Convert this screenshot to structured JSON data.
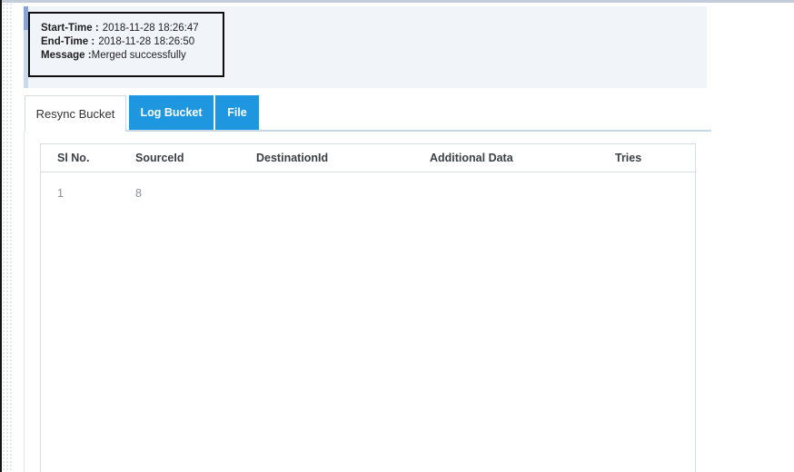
{
  "panel": {
    "start_time_label": "Start-Time :",
    "start_time_value": "2018-11-28 18:26:47",
    "end_time_label": "End-Time :",
    "end_time_value": "2018-11-28 18:26:50",
    "message_label": "Message :",
    "message_value": "Merged successfully"
  },
  "tabs": [
    {
      "label": "Resync Bucket",
      "active": true
    },
    {
      "label": "Log Bucket",
      "active": false
    },
    {
      "label": "File",
      "active": false
    }
  ],
  "table": {
    "columns": [
      "Sl No.",
      "SourceId",
      "DestinationId",
      "Additional Data",
      "Tries"
    ],
    "rows": [
      [
        "1",
        "8",
        "",
        "",
        ""
      ]
    ]
  },
  "colors": {
    "tab_blue": "#1e96e0",
    "panel_bg": "#f1f5fa",
    "top_line": "#c3ccda",
    "table_border": "#d9dee4",
    "row_text_gray": "#8a8f94",
    "info_box_border": "#0d0d0d"
  }
}
